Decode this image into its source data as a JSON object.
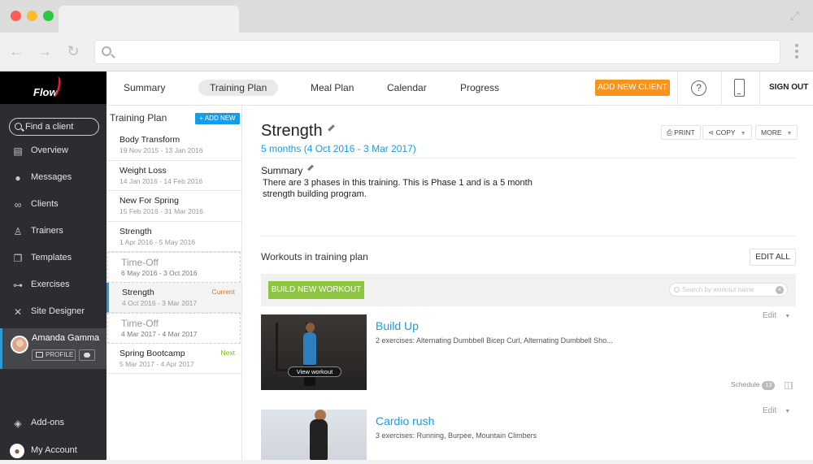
{
  "browser": {
    "back_icon": "arrow-left-icon",
    "forward_icon": "arrow-right-icon",
    "reload_icon": "reload-icon"
  },
  "brand": {
    "logo_text": "Flow",
    "accent": "#e8173c"
  },
  "sidebar": {
    "search_placeholder": "Find a client",
    "items": [
      {
        "label": "Overview",
        "icon": "overview-icon"
      },
      {
        "label": "Messages",
        "icon": "messages-icon"
      },
      {
        "label": "Clients",
        "icon": "clients-icon"
      },
      {
        "label": "Trainers",
        "icon": "trainers-icon"
      },
      {
        "label": "Templates",
        "icon": "templates-icon"
      },
      {
        "label": "Exercises",
        "icon": "dumbbell-icon"
      },
      {
        "label": "Site Designer",
        "icon": "site-designer-icon"
      }
    ],
    "user": {
      "name": "Amanda Gamma",
      "profile_label": "PROFILE"
    },
    "bottom": [
      {
        "label": "Add-ons",
        "icon": "addons-icon"
      },
      {
        "label": "My Account",
        "icon": "account-avatar"
      }
    ]
  },
  "topnav": {
    "tabs": [
      "Summary",
      "Training Plan",
      "Meal Plan",
      "Calendar",
      "Progress"
    ],
    "active_tab": "Training Plan",
    "add_client": "ADD NEW CLIENT",
    "help_glyph": "?",
    "sign_out": "SIGN OUT"
  },
  "plans": {
    "header": "Training Plan",
    "add_new": "+ ADD NEW",
    "items": [
      {
        "name": "Body Transform",
        "dates": "19 Nov 2015 - 13 Jan 2016",
        "style": "normal",
        "tag": ""
      },
      {
        "name": "Weight Loss",
        "dates": "14 Jan 2016 - 14 Feb 2016",
        "style": "normal",
        "tag": ""
      },
      {
        "name": "New For Spring",
        "dates": "15 Feb 2016 - 31 Mar 2016",
        "style": "normal",
        "tag": ""
      },
      {
        "name": "Strength",
        "dates": "1 Apr 2016 - 5 May 2016",
        "style": "normal",
        "tag": ""
      },
      {
        "name": "Time-Off",
        "dates": "6 May 2016 - 3 Oct 2016",
        "style": "dashed",
        "tag": ""
      },
      {
        "name": "Strength",
        "dates": "4 Oct 2016 - 3 Mar 2017",
        "style": "active",
        "tag": "Current"
      },
      {
        "name": "Time-Off",
        "dates": "4 Mar 2017 - 4 Mar 2017",
        "style": "dashed",
        "tag": ""
      },
      {
        "name": "Spring Bootcamp",
        "dates": "5 Mar 2017 - 4 Apr 2017",
        "style": "normal",
        "tag": "Next"
      }
    ],
    "tag_colors": {
      "Current": "#e8731c",
      "Next": "#7cb518"
    }
  },
  "main": {
    "title": "Strength",
    "range": "5 months (4 Oct 2016 - 3 Mar 2017)",
    "actions": {
      "print": "PRINT",
      "copy": "COPY",
      "more": "MORE"
    },
    "summary_label": "Summary",
    "summary_text": "There are 3 phases in this training. This is Phase 1 and is a 5 month strength building program.",
    "workouts_header": "Workouts in training plan",
    "edit_all": "EDIT ALL",
    "build_new": "BUILD NEW WORKOUT",
    "search_placeholder": "Search by workout name",
    "workouts": [
      {
        "name": "Build Up",
        "desc": "2 exercises: Alternating Dumbbell Bicep Curl, Alternating Dumbbell Sho...",
        "edit": "Edit",
        "view": "View workout",
        "schedule": "Schedule",
        "schedule_count": "13"
      },
      {
        "name": "Cardio rush",
        "desc": "3 exercises: Running, Burpee, Mountain Climbers",
        "edit": "Edit"
      }
    ]
  }
}
